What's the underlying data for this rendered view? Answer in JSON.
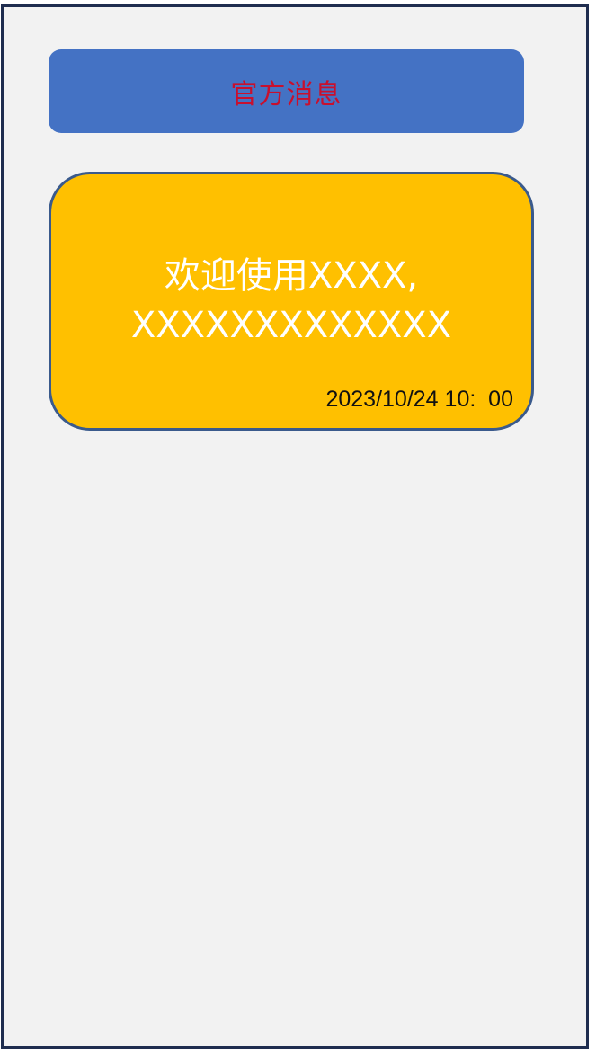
{
  "header": {
    "title": "官方消息"
  },
  "message": {
    "line1": "欢迎使用XXXX,",
    "line2": "XXXXXXXXXXXXX",
    "timestamp": "2023/10/24 10:  00"
  },
  "colors": {
    "header_bg": "#4472c4",
    "header_text": "#c8102e",
    "card_bg": "#ffc000",
    "card_border": "#3a5a8c",
    "page_bg": "#f2f2f2",
    "frame_border": "#1f2d4f"
  }
}
